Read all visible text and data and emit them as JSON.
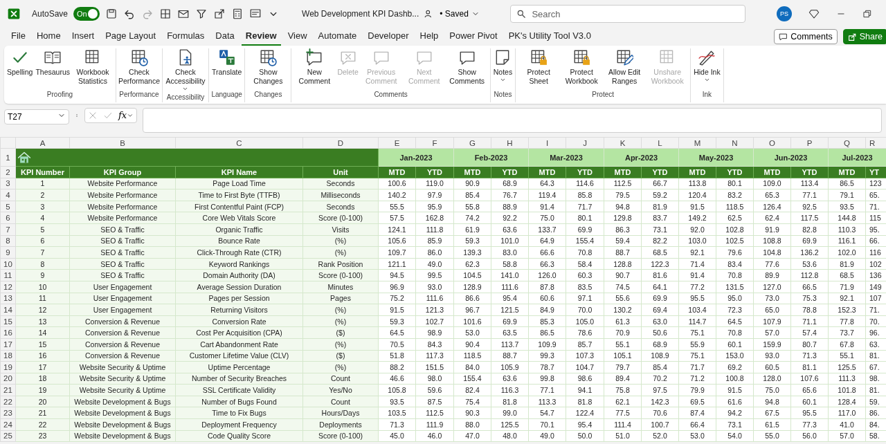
{
  "title_bar": {
    "autosave_label": "AutoSave",
    "autosave": {
      "label": "On",
      "on": true
    },
    "document_title": "Web Development KPI Dashb...",
    "save_status": "• Saved",
    "search": {
      "placeholder": "Search"
    },
    "avatar": "PS"
  },
  "menu_tabs": [
    {
      "label": "File",
      "selected": false
    },
    {
      "label": "Home",
      "selected": false
    },
    {
      "label": "Insert",
      "selected": false
    },
    {
      "label": "Page Layout",
      "selected": false
    },
    {
      "label": "Formulas",
      "selected": false
    },
    {
      "label": "Data",
      "selected": false
    },
    {
      "label": "Review",
      "selected": true
    },
    {
      "label": "View",
      "selected": false
    },
    {
      "label": "Automate",
      "selected": false
    },
    {
      "label": "Developer",
      "selected": false
    },
    {
      "label": "Help",
      "selected": false
    },
    {
      "label": "Power Pivot",
      "selected": false
    },
    {
      "label": "PK's Utility Tool V3.0",
      "selected": false
    }
  ],
  "header_buttons": {
    "comments": "Comments",
    "share": "Share"
  },
  "ribbon_groups": [
    {
      "label": "Proofing",
      "buttons": [
        {
          "label": "Spelling",
          "disabled": false
        },
        {
          "label": "Thesaurus",
          "disabled": false
        },
        {
          "label": "Workbook Statistics",
          "disabled": false
        }
      ]
    },
    {
      "label": "Performance",
      "buttons": [
        {
          "label": "Check Performance",
          "disabled": false
        }
      ]
    },
    {
      "label": "Accessibility",
      "buttons": [
        {
          "label": "Check Accessibility",
          "disabled": false,
          "dropdown": true
        }
      ]
    },
    {
      "label": "Language",
      "buttons": [
        {
          "label": "Translate",
          "disabled": false
        }
      ]
    },
    {
      "label": "Changes",
      "buttons": [
        {
          "label": "Show Changes",
          "disabled": false
        }
      ]
    },
    {
      "label": "Comments",
      "buttons": [
        {
          "label": "New Comment",
          "disabled": false
        },
        {
          "label": "Delete",
          "disabled": true
        },
        {
          "label": "Previous Comment",
          "disabled": true
        },
        {
          "label": "Next Comment",
          "disabled": true
        },
        {
          "label": "Show Comments",
          "disabled": false
        }
      ]
    },
    {
      "label": "Notes",
      "buttons": [
        {
          "label": "Notes",
          "disabled": false,
          "dropdown": true
        }
      ]
    },
    {
      "label": "Protect",
      "buttons": [
        {
          "label": "Protect Sheet",
          "disabled": false
        },
        {
          "label": "Protect Workbook",
          "disabled": false
        },
        {
          "label": "Allow Edit Ranges",
          "disabled": false
        },
        {
          "label": "Unshare Workbook",
          "disabled": true
        }
      ]
    },
    {
      "label": "Ink",
      "buttons": [
        {
          "label": "Hide Ink",
          "disabled": false,
          "dropdown": true
        }
      ]
    }
  ],
  "formula_bar": {
    "name_box": "T27",
    "function_label": "fx"
  },
  "sheet": {
    "column_letters": [
      "A",
      "B",
      "C",
      "D",
      "E",
      "F",
      "G",
      "H",
      "I",
      "J",
      "K",
      "L",
      "M",
      "N",
      "O",
      "P",
      "Q",
      "R"
    ],
    "row_numbers": [
      "1",
      "2",
      "3",
      "4",
      "5",
      "6",
      "7",
      "8",
      "9",
      "10",
      "11",
      "12",
      "13",
      "14",
      "15",
      "16",
      "17",
      "18",
      "19",
      "20",
      "21",
      "22",
      "23",
      "24",
      "25"
    ],
    "months": [
      "Jan-2023",
      "Feb-2023",
      "Mar-2023",
      "Apr-2023",
      "May-2023",
      "Jun-2023",
      "Jul-2023"
    ],
    "header_row": [
      "KPI Number",
      "KPI Group",
      "KPI Name",
      "Unit",
      "MTD",
      "YTD",
      "MTD",
      "YTD",
      "MTD",
      "YTD",
      "MTD",
      "YTD",
      "MTD",
      "YTD",
      "MTD",
      "YTD",
      "MTD",
      "YT"
    ],
    "rows": [
      [
        "1",
        "Website Performance",
        "Page Load Time",
        "Seconds",
        "100.6",
        "119.0",
        "90.9",
        "68.9",
        "64.3",
        "114.6",
        "112.5",
        "66.7",
        "113.8",
        "80.1",
        "109.0",
        "113.4",
        "86.5",
        "123"
      ],
      [
        "2",
        "Website Performance",
        "Time to First Byte (TTFB)",
        "Milliseconds",
        "140.2",
        "97.9",
        "85.4",
        "76.7",
        "119.4",
        "85.8",
        "79.5",
        "59.2",
        "120.4",
        "83.2",
        "65.3",
        "77.1",
        "79.1",
        "65."
      ],
      [
        "3",
        "Website Performance",
        "First Contentful Paint (FCP)",
        "Seconds",
        "55.5",
        "95.9",
        "55.8",
        "88.9",
        "91.4",
        "71.7",
        "94.8",
        "81.9",
        "91.5",
        "118.5",
        "126.4",
        "92.5",
        "93.5",
        "71."
      ],
      [
        "4",
        "Website Performance",
        "Core Web Vitals Score",
        "Score (0-100)",
        "57.5",
        "162.8",
        "74.2",
        "92.2",
        "75.0",
        "80.1",
        "129.8",
        "83.7",
        "149.2",
        "62.5",
        "62.4",
        "117.5",
        "144.8",
        "115"
      ],
      [
        "5",
        "SEO & Traffic",
        "Organic Traffic",
        "Visits",
        "124.1",
        "111.8",
        "61.9",
        "63.6",
        "133.7",
        "69.9",
        "86.3",
        "73.1",
        "92.0",
        "102.8",
        "91.9",
        "82.8",
        "110.3",
        "95."
      ],
      [
        "6",
        "SEO & Traffic",
        "Bounce Rate",
        "(%)",
        "105.6",
        "85.9",
        "59.3",
        "101.0",
        "64.9",
        "155.4",
        "59.4",
        "82.2",
        "103.0",
        "102.5",
        "108.8",
        "69.9",
        "116.1",
        "66."
      ],
      [
        "7",
        "SEO & Traffic",
        "Click-Through Rate (CTR)",
        "(%)",
        "109.7",
        "86.0",
        "139.3",
        "83.0",
        "66.6",
        "70.8",
        "88.7",
        "68.5",
        "92.1",
        "79.6",
        "104.8",
        "136.2",
        "102.0",
        "116"
      ],
      [
        "8",
        "SEO & Traffic",
        "Keyword Rankings",
        "Rank Position",
        "121.1",
        "49.0",
        "62.3",
        "58.8",
        "66.3",
        "58.4",
        "128.8",
        "122.3",
        "71.4",
        "83.4",
        "77.6",
        "53.6",
        "81.9",
        "102"
      ],
      [
        "9",
        "SEO & Traffic",
        "Domain Authority (DA)",
        "Score (0-100)",
        "94.5",
        "99.5",
        "104.5",
        "141.0",
        "126.0",
        "60.3",
        "90.7",
        "81.6",
        "91.4",
        "70.8",
        "89.9",
        "112.8",
        "68.5",
        "136"
      ],
      [
        "10",
        "User Engagement",
        "Average Session Duration",
        "Minutes",
        "96.9",
        "93.0",
        "128.9",
        "111.6",
        "87.8",
        "83.5",
        "74.5",
        "64.1",
        "77.2",
        "131.5",
        "127.0",
        "66.5",
        "71.9",
        "149"
      ],
      [
        "11",
        "User Engagement",
        "Pages per Session",
        "Pages",
        "75.2",
        "111.6",
        "86.6",
        "95.4",
        "60.6",
        "97.1",
        "55.6",
        "69.9",
        "95.5",
        "95.0",
        "73.0",
        "75.3",
        "92.1",
        "107"
      ],
      [
        "12",
        "User Engagement",
        "Returning Visitors",
        "(%)",
        "91.5",
        "121.3",
        "96.7",
        "121.5",
        "84.9",
        "70.0",
        "130.2",
        "69.4",
        "103.4",
        "72.3",
        "65.0",
        "78.8",
        "152.3",
        "71."
      ],
      [
        "13",
        "Conversion & Revenue",
        "Conversion Rate",
        "(%)",
        "59.3",
        "102.7",
        "101.6",
        "69.9",
        "85.3",
        "105.0",
        "61.3",
        "63.0",
        "114.7",
        "64.5",
        "107.9",
        "71.1",
        "77.8",
        "70."
      ],
      [
        "14",
        "Conversion & Revenue",
        "Cost Per Acquisition (CPA)",
        "($)",
        "64.5",
        "98.9",
        "53.0",
        "63.5",
        "86.5",
        "78.6",
        "70.9",
        "50.6",
        "75.1",
        "70.8",
        "57.0",
        "57.4",
        "73.7",
        "96."
      ],
      [
        "15",
        "Conversion & Revenue",
        "Cart Abandonment Rate",
        "(%)",
        "70.5",
        "84.3",
        "90.4",
        "113.7",
        "109.9",
        "85.7",
        "55.1",
        "68.9",
        "55.9",
        "60.1",
        "159.9",
        "80.7",
        "67.8",
        "63."
      ],
      [
        "16",
        "Conversion & Revenue",
        "Customer Lifetime Value (CLV)",
        "($)",
        "51.8",
        "117.3",
        "118.5",
        "88.7",
        "99.3",
        "107.3",
        "105.1",
        "108.9",
        "75.1",
        "153.0",
        "93.0",
        "71.3",
        "55.1",
        "81."
      ],
      [
        "17",
        "Website Security & Uptime",
        "Uptime Percentage",
        "(%)",
        "88.2",
        "151.5",
        "84.0",
        "105.9",
        "78.7",
        "104.7",
        "79.7",
        "85.4",
        "71.7",
        "69.2",
        "60.5",
        "81.1",
        "125.5",
        "67."
      ],
      [
        "18",
        "Website Security & Uptime",
        "Number of Security Breaches",
        "Count",
        "46.6",
        "98.0",
        "155.4",
        "63.6",
        "99.8",
        "98.6",
        "89.4",
        "70.2",
        "71.2",
        "100.8",
        "128.0",
        "107.6",
        "111.3",
        "98."
      ],
      [
        "19",
        "Website Security & Uptime",
        "SSL Certificate Validity",
        "Yes/No",
        "105.8",
        "59.6",
        "82.4",
        "116.3",
        "77.1",
        "94.1",
        "75.8",
        "97.5",
        "79.9",
        "91.5",
        "75.0",
        "65.6",
        "101.8",
        "81."
      ],
      [
        "20",
        "Website Development & Bugs",
        "Number of Bugs Found",
        "Count",
        "93.5",
        "87.5",
        "75.4",
        "81.8",
        "113.3",
        "81.8",
        "62.1",
        "142.3",
        "69.5",
        "61.6",
        "94.8",
        "60.1",
        "128.4",
        "59."
      ],
      [
        "21",
        "Website Development & Bugs",
        "Time to Fix Bugs",
        "Hours/Days",
        "103.5",
        "112.5",
        "90.3",
        "99.0",
        "54.7",
        "122.4",
        "77.5",
        "70.6",
        "87.4",
        "94.2",
        "67.5",
        "95.5",
        "117.0",
        "86."
      ],
      [
        "22",
        "Website Development & Bugs",
        "Deployment Frequency",
        "Deployments",
        "71.3",
        "111.9",
        "88.0",
        "125.5",
        "70.1",
        "95.4",
        "111.4",
        "100.7",
        "66.4",
        "73.1",
        "61.5",
        "77.3",
        "41.0",
        "84."
      ],
      [
        "23",
        "Website Development & Bugs",
        "Code Quality Score",
        "Score (0-100)",
        "45.0",
        "46.0",
        "47.0",
        "48.0",
        "49.0",
        "50.0",
        "51.0",
        "52.0",
        "53.0",
        "54.0",
        "55.0",
        "56.0",
        "57.0",
        "58."
      ]
    ]
  }
}
